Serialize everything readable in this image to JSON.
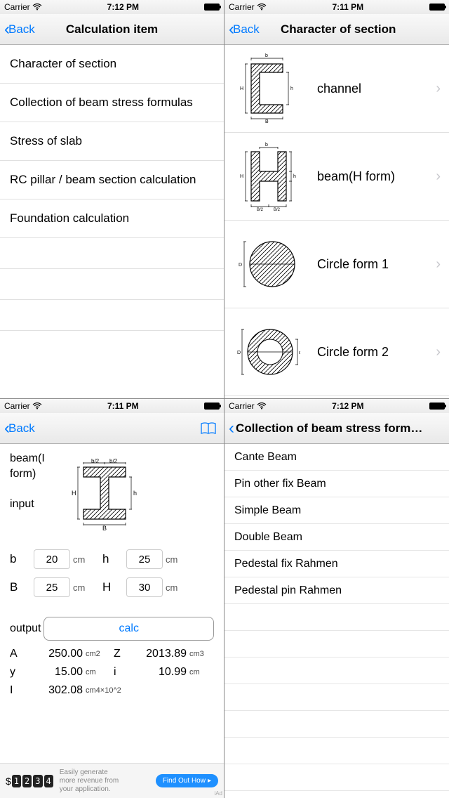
{
  "status": {
    "carrier": "Carrier",
    "time1": "7:12 PM",
    "time2": "7:11 PM"
  },
  "screen1": {
    "back": "Back",
    "title": "Calculation item",
    "items": [
      "Character of section",
      "Collection of beam stress formulas",
      "Stress of slab",
      "RC pillar / beam section calculation",
      "Foundation calculation"
    ]
  },
  "screen2": {
    "back": "Back",
    "title": "Character of section",
    "rows": [
      "channel",
      "beam(H form)",
      "Circle form 1",
      "Circle form 2"
    ]
  },
  "screen3": {
    "back": "Back",
    "formLabel1": "beam(I form)",
    "formLabel2": "input",
    "diagLabels": {
      "b2l": "b/2",
      "b2r": "b/2",
      "H": "H",
      "h": "h",
      "B": "B"
    },
    "inputs": {
      "b": {
        "label": "b",
        "value": "20",
        "unit": "cm"
      },
      "h": {
        "label": "h",
        "value": "25",
        "unit": "cm"
      },
      "B": {
        "label": "B",
        "value": "25",
        "unit": "cm"
      },
      "Hcap": {
        "label": "H",
        "value": "30",
        "unit": "cm"
      }
    },
    "outputLabel": "output",
    "calc": "calc",
    "outputs": {
      "A": {
        "label": "A",
        "value": "250.00",
        "unit": "cm2"
      },
      "Z": {
        "label": "Z",
        "value": "2013.89",
        "unit": "cm3"
      },
      "y": {
        "label": "y",
        "value": "15.00",
        "unit": "cm"
      },
      "i": {
        "label": "i",
        "value": "10.99",
        "unit": "cm"
      },
      "I": {
        "label": "I",
        "value": "302.08",
        "unit": "cm4×10^2"
      }
    },
    "ad": {
      "currency": "$",
      "digits": [
        "1",
        "2",
        "3",
        "4"
      ],
      "text1": "Easily generate",
      "text2": "more revenue from",
      "text3": "your application.",
      "cta": "Find Out How",
      "badge": "iAd"
    }
  },
  "screen4": {
    "title": "Collection of beam stress form…",
    "items": [
      "Cante Beam",
      "Pin other fix Beam",
      "Simple Beam",
      "Double Beam",
      "Pedestal fix Rahmen",
      "Pedestal pin Rahmen"
    ]
  }
}
